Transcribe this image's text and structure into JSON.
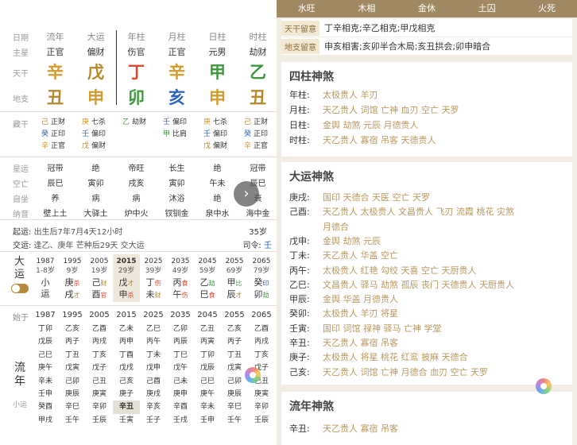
{
  "pillars": {
    "row_labels": [
      "日期",
      "主星",
      "天干",
      "地支"
    ],
    "columns": [
      {
        "head": "流年",
        "star": "正官",
        "stem": "辛",
        "stem_color": "#d49a2c",
        "branch": "丑",
        "branch_color": "#b5892c"
      },
      {
        "head": "大运",
        "star": "偏财",
        "stem": "戊",
        "stem_color": "#b5892c",
        "branch": "申",
        "branch_color": "#d49a2c"
      },
      {
        "head": "年柱",
        "star": "伤官",
        "stem": "丁",
        "stem_color": "#d9482f",
        "branch": "卯",
        "branch_color": "#3a9a3a"
      },
      {
        "head": "月柱",
        "star": "正官",
        "stem": "辛",
        "stem_color": "#d49a2c",
        "branch": "亥",
        "branch_color": "#2c64c2"
      },
      {
        "head": "日柱",
        "star": "元男",
        "stem": "甲",
        "stem_color": "#3a9a3a",
        "branch": "申",
        "branch_color": "#d49a2c"
      },
      {
        "head": "时柱",
        "star": "劫财",
        "stem": "乙",
        "stem_color": "#3a9a3a",
        "branch": "丑",
        "branch_color": "#b5892c"
      }
    ]
  },
  "hidden": {
    "label": "藏干",
    "cols": [
      [
        [
          "己",
          "正财"
        ],
        [
          "癸",
          "正印"
        ],
        [
          "辛",
          "正官"
        ]
      ],
      [
        [
          "庚",
          "七杀"
        ],
        [
          "壬",
          "偏印"
        ],
        [
          "戊",
          "偏财"
        ]
      ],
      [
        [
          "乙",
          "劫财"
        ]
      ],
      [
        [
          "壬",
          "偏印"
        ],
        [
          "甲",
          "比肩"
        ]
      ],
      [
        [
          "庚",
          "七杀"
        ],
        [
          "壬",
          "偏印"
        ],
        [
          "戊",
          "偏财"
        ]
      ],
      [
        [
          "己",
          "正财"
        ],
        [
          "癸",
          "正印"
        ],
        [
          "辛",
          "正官"
        ]
      ]
    ]
  },
  "stars": {
    "rows": [
      {
        "label": "星运",
        "vals": [
          "冠带",
          "绝",
          "帝旺",
          "长生",
          "绝",
          "冠带"
        ]
      },
      {
        "label": "空亡",
        "vals": [
          "辰巳",
          "寅卯",
          "戌亥",
          "寅卯",
          "午未",
          "辰巳"
        ]
      },
      {
        "label": "自坐",
        "vals": [
          "养",
          "病",
          "病",
          "沐浴",
          "绝",
          "衰"
        ]
      },
      {
        "label": "纳音",
        "vals": [
          "壁上土",
          "大驿土",
          "炉中火",
          "钗钏金",
          "泉中水",
          "海中金"
        ]
      }
    ]
  },
  "qiyun": {
    "label": "起运:",
    "text": "出生后7年7月4天12小时",
    "years": "35岁"
  },
  "jiaoyun": {
    "label": "交运:",
    "text": "逢乙、庚年 芒种后29天 交大运",
    "siling_label": "司令:",
    "siling": "壬"
  },
  "dayun": {
    "label1": "大",
    "label2": "运",
    "cols": [
      {
        "year": "1987",
        "age": "1-8岁",
        "gan": "小",
        "zhi": "运",
        "gs": "",
        "zs": ""
      },
      {
        "year": "1995",
        "age": "9岁",
        "gan": "庚",
        "zhi": "戌",
        "gs": "杀",
        "zs": "才"
      },
      {
        "year": "2005",
        "age": "19岁",
        "gan": "己",
        "zhi": "酉",
        "gs": "财",
        "zs": "官"
      },
      {
        "year": "2015",
        "age": "29岁",
        "gan": "戊",
        "zhi": "申",
        "gs": "才",
        "zs": "杀"
      },
      {
        "year": "2025",
        "age": "39岁",
        "gan": "丁",
        "zhi": "未",
        "gs": "伤",
        "zs": "财"
      },
      {
        "year": "2035",
        "age": "49岁",
        "gan": "丙",
        "zhi": "午",
        "gs": "食",
        "zs": "伤"
      },
      {
        "year": "2045",
        "age": "59岁",
        "gan": "乙",
        "zhi": "巳",
        "gs": "劫",
        "zs": "食"
      },
      {
        "year": "2055",
        "age": "69岁",
        "gan": "甲",
        "zhi": "辰",
        "gs": "比",
        "zs": "才"
      },
      {
        "year": "2065",
        "age": "79岁",
        "gan": "癸",
        "zhi": "卯",
        "gs": "印",
        "zs": "劫"
      }
    ]
  },
  "liunian": {
    "shiyu": "始于",
    "label1": "流",
    "label2": "年",
    "sub": "小运",
    "cols": [
      {
        "year": "1987",
        "items": [
          "丁卯",
          "戊辰",
          "己巳",
          "庚午",
          "辛未",
          "壬申",
          "癸酉",
          "甲戌"
        ]
      },
      {
        "year": "1995",
        "items": [
          "乙亥",
          "丙子",
          "丁丑",
          "戊寅",
          "己卯",
          "庚辰",
          "辛巳",
          "壬午"
        ]
      },
      {
        "year": "2005",
        "items": [
          "乙酉",
          "丙戌",
          "丁亥",
          "戊子",
          "己丑",
          "庚寅",
          "辛卯",
          "壬辰"
        ]
      },
      {
        "year": "2015",
        "items": [
          "乙未",
          "丙申",
          "丁酉",
          "戊戌",
          "己亥",
          "庚子",
          "辛丑",
          "壬寅"
        ]
      },
      {
        "year": "2025",
        "items": [
          "乙巳",
          "丙午",
          "丁未",
          "戊申",
          "己酉",
          "庚戌",
          "辛亥",
          "壬子"
        ]
      },
      {
        "year": "2035",
        "items": [
          "乙卯",
          "丙辰",
          "丁巳",
          "戊午",
          "己未",
          "庚申",
          "辛酉",
          "壬戌"
        ]
      },
      {
        "year": "2045",
        "items": [
          "乙丑",
          "丙寅",
          "丁卯",
          "戊辰",
          "己巳",
          "庚午",
          "辛未",
          "壬申"
        ]
      },
      {
        "year": "2055",
        "items": [
          "乙亥",
          "丙子",
          "丁丑",
          "戊寅",
          "己卯",
          "庚辰",
          "辛巳",
          "壬午"
        ]
      },
      {
        "year": "2065",
        "items": [
          "乙酉",
          "丙戌",
          "丁亥",
          "戊子",
          "己丑",
          "庚寅",
          "辛卯",
          "壬辰"
        ]
      }
    ]
  },
  "wuxing": [
    "水旺",
    "木相",
    "金休",
    "土囚",
    "火死"
  ],
  "tiangan": {
    "tag": "天干留意",
    "text": "丁辛相克;辛乙相克;甲戊相克"
  },
  "dizhi": {
    "tag": "地支留意",
    "text": "申亥相害;亥卯半合木局;亥丑拱会;卯申暗合"
  },
  "sizhu": {
    "title": "四柱神煞",
    "rows": [
      {
        "k": "年柱:",
        "v": "太极贵人 羊刃"
      },
      {
        "k": "月柱:",
        "v": "天乙贵人 词馆 亡神 血刃 空亡 天罗"
      },
      {
        "k": "日柱:",
        "v": "金舆 劫煞 元辰 月德贵人"
      },
      {
        "k": "时柱:",
        "v": "天乙贵人 寡宿 吊客 天德贵人"
      }
    ]
  },
  "dayunshensha": {
    "title": "大运神煞",
    "rows": [
      {
        "k": "庚戌:",
        "v": "国印 天德合 天医 空亡 天罗"
      },
      {
        "k": "己酉:",
        "v": "天乙贵人 太极贵人 文昌贵人 飞刃 流霞 桃花 灾煞"
      },
      {
        "k": "",
        "v": "月德合"
      },
      {
        "k": "戊申:",
        "v": "金舆 劫煞 元辰"
      },
      {
        "k": "丁未:",
        "v": "天乙贵人 华盖 空亡"
      },
      {
        "k": "丙午:",
        "v": "太极贵人 红艳 勾绞 天喜 空亡 天厨贵人"
      },
      {
        "k": "乙巳:",
        "v": "文昌贵人 驿马 劫煞 孤辰 丧门 天德贵人 天厨贵人"
      },
      {
        "k": "甲辰:",
        "v": "金舆 华盖 月德贵人"
      },
      {
        "k": "癸卯:",
        "v": "太极贵人 羊刃 将星"
      },
      {
        "k": "壬寅:",
        "v": "国印 词馆 禄神 驿马 亡神 学堂"
      },
      {
        "k": "辛丑:",
        "v": "天乙贵人 寡宿 吊客"
      },
      {
        "k": "庚子:",
        "v": "太极贵人 将星 桃花 红鸾 披麻 天德合"
      },
      {
        "k": "己亥:",
        "v": "天乙贵人 词馆 亡神 月德合 血刃 空亡 天罗"
      }
    ]
  },
  "liunianshensha": {
    "title": "流年神煞",
    "rows": [
      {
        "k": "辛丑:",
        "v": "天乙贵人 寡宿 吊客"
      }
    ]
  },
  "colors": {
    "gold": "#b9985f",
    "banner": "#a08962",
    "red": "#d9482f",
    "green": "#3a9a3a",
    "blue": "#2c64c2"
  }
}
